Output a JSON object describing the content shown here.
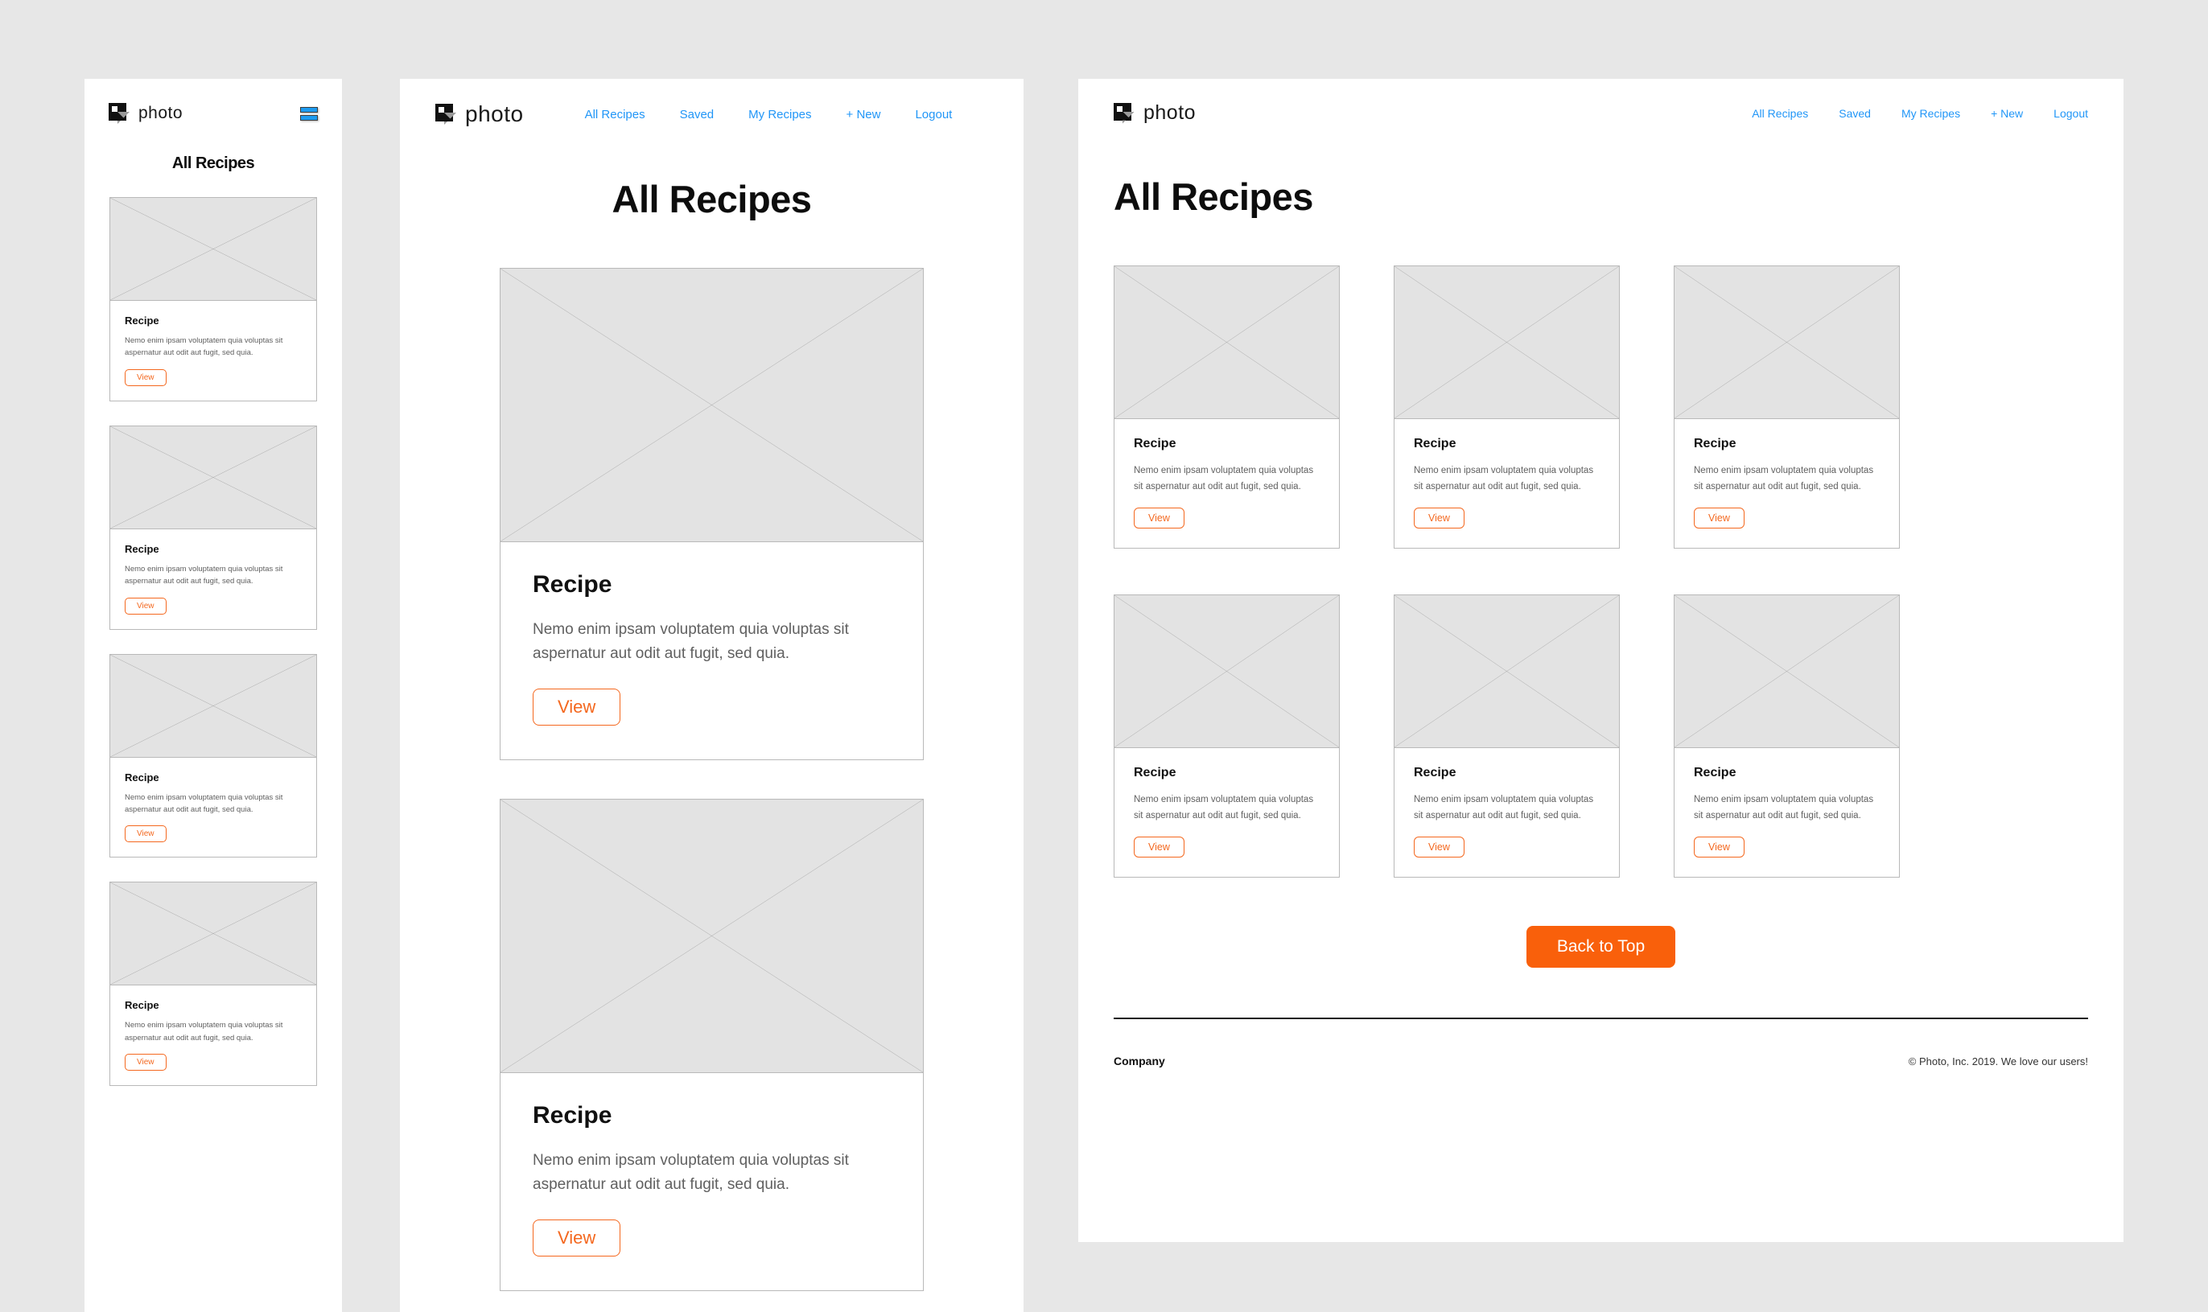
{
  "brand": {
    "name": "photo",
    "logo_icon": "photo-logo-icon"
  },
  "nav": {
    "items": [
      {
        "label": "All Recipes"
      },
      {
        "label": "Saved"
      },
      {
        "label": "My Recipes"
      },
      {
        "label": "+ New"
      },
      {
        "label": "Logout"
      }
    ],
    "menu_icon": "hamburger-menu-icon",
    "link_color": "#2196f7"
  },
  "page": {
    "title": "All Recipes"
  },
  "card": {
    "title": "Recipe",
    "text": "Nemo enim ipsam voluptatem quia voluptas sit aspernatur aut odit aut fugit, sed quia.",
    "button_label": "View",
    "image_icon": "image-placeholder-icon",
    "accent_color": "#f4681f"
  },
  "cards": [
    {
      "title": "Recipe",
      "text": "Nemo enim ipsam voluptatem quia voluptas sit aspernatur aut odit aut fugit, sed quia.",
      "button_label": "View"
    },
    {
      "title": "Recipe",
      "text": "Nemo enim ipsam voluptatem quia voluptas sit aspernatur aut odit aut fugit, sed quia.",
      "button_label": "View"
    },
    {
      "title": "Recipe",
      "text": "Nemo enim ipsam voluptatem quia voluptas sit aspernatur aut odit aut fugit, sed quia.",
      "button_label": "View"
    },
    {
      "title": "Recipe",
      "text": "Nemo enim ipsam voluptatem quia voluptas sit aspernatur aut odit aut fugit, sed quia.",
      "button_label": "View"
    },
    {
      "title": "Recipe",
      "text": "Nemo enim ipsam voluptatem quia voluptas sit aspernatur aut odit aut fugit, sed quia.",
      "button_label": "View"
    },
    {
      "title": "Recipe",
      "text": "Nemo enim ipsam voluptatem quia voluptas sit aspernatur aut odit aut fugit, sed quia.",
      "button_label": "View"
    }
  ],
  "back_to_top": {
    "label": "Back to Top",
    "color": "#f9600b"
  },
  "footer": {
    "company_label": "Company",
    "copyright": "© Photo, Inc. 2019. We love our users!"
  }
}
